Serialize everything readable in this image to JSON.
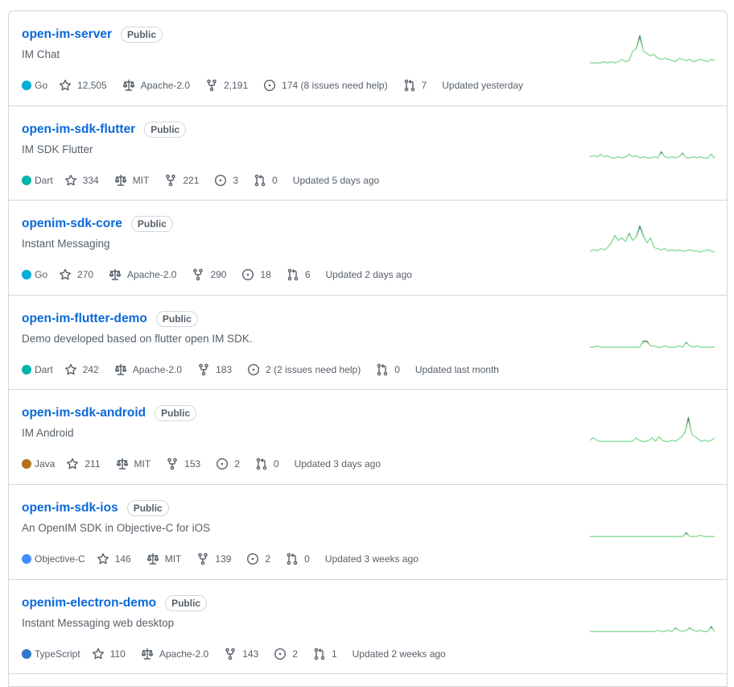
{
  "repos": [
    {
      "name": "open-im-server",
      "visibility": "Public",
      "description": "IM Chat",
      "language": "Go",
      "language_color": "#00ADD8",
      "stars": "12,505",
      "license": "Apache-2.0",
      "forks": "2,191",
      "issues": "174 (8 issues need help)",
      "pulls": "7",
      "updated": "Updated yesterday",
      "activity": [
        2,
        2,
        2,
        2,
        3,
        2,
        3,
        2,
        3,
        5,
        3,
        4,
        12,
        14,
        25,
        12,
        10,
        8,
        9,
        6,
        5,
        6,
        5,
        4,
        3,
        6,
        5,
        4,
        5,
        3,
        4,
        5,
        4,
        3,
        5,
        4
      ]
    },
    {
      "name": "open-im-sdk-flutter",
      "visibility": "Public",
      "description": "IM SDK Flutter",
      "language": "Dart",
      "language_color": "#00B4AB",
      "stars": "334",
      "license": "MIT",
      "forks": "221",
      "issues": "3",
      "pulls": "0",
      "updated": "Updated 5 days ago",
      "activity": [
        3,
        4,
        3,
        5,
        3,
        4,
        2,
        2,
        3,
        2,
        3,
        5,
        3,
        4,
        2,
        3,
        2,
        2,
        3,
        2,
        7,
        3,
        2,
        3,
        2,
        3,
        6,
        2,
        2,
        3,
        2,
        3,
        2,
        2,
        5,
        2
      ]
    },
    {
      "name": "openim-sdk-core",
      "visibility": "Public",
      "description": "Instant Messaging",
      "language": "Go",
      "language_color": "#00ADD8",
      "stars": "270",
      "license": "Apache-2.0",
      "forks": "290",
      "issues": "18",
      "pulls": "6",
      "updated": "Updated 2 days ago",
      "activity": [
        3,
        4,
        3,
        5,
        4,
        6,
        10,
        16,
        12,
        14,
        11,
        18,
        12,
        15,
        24,
        16,
        10,
        14,
        6,
        5,
        4,
        5,
        3,
        4,
        3,
        4,
        3,
        3,
        4,
        3,
        3,
        2,
        3,
        4,
        3,
        2
      ]
    },
    {
      "name": "open-im-flutter-demo",
      "visibility": "Public",
      "description": "Demo developed based on flutter open IM SDK.",
      "language": "Dart",
      "language_color": "#00B4AB",
      "stars": "242",
      "license": "Apache-2.0",
      "forks": "183",
      "issues": "2 (2 issues need help)",
      "pulls": "0",
      "updated": "Updated last month",
      "activity": [
        2,
        2,
        3,
        2,
        2,
        2,
        2,
        2,
        2,
        2,
        2,
        2,
        2,
        2,
        2,
        7,
        7,
        3,
        3,
        2,
        2,
        3,
        2,
        2,
        2,
        3,
        2,
        6,
        3,
        2,
        3,
        2,
        2,
        2,
        2,
        2
      ]
    },
    {
      "name": "open-im-sdk-android",
      "visibility": "Public",
      "description": "IM Android",
      "language": "Java",
      "language_color": "#b07219",
      "stars": "211",
      "license": "MIT",
      "forks": "153",
      "issues": "2",
      "pulls": "0",
      "updated": "Updated 3 days ago",
      "activity": [
        3,
        5,
        3,
        2,
        2,
        2,
        2,
        2,
        2,
        2,
        2,
        2,
        2,
        2,
        5,
        3,
        2,
        2,
        3,
        5,
        2,
        6,
        3,
        2,
        2,
        3,
        2,
        4,
        6,
        10,
        22,
        8,
        6,
        4,
        2,
        3,
        2,
        3,
        5
      ]
    },
    {
      "name": "open-im-sdk-ios",
      "visibility": "Public",
      "description": "An OpenIM SDK in Objective-C for iOS",
      "language": "Objective-C",
      "language_color": "#438eff",
      "stars": "146",
      "license": "MIT",
      "forks": "139",
      "issues": "2",
      "pulls": "0",
      "updated": "Updated 3 weeks ago",
      "activity": [
        2,
        2,
        2,
        2,
        2,
        2,
        2,
        2,
        2,
        2,
        2,
        2,
        2,
        2,
        2,
        2,
        2,
        2,
        2,
        2,
        2,
        2,
        2,
        2,
        2,
        2,
        2,
        5,
        2,
        2,
        2,
        3,
        2,
        2,
        2,
        2
      ]
    },
    {
      "name": "openim-electron-demo",
      "visibility": "Public",
      "description": "Instant Messaging web desktop",
      "language": "TypeScript",
      "language_color": "#3178c6",
      "stars": "110",
      "license": "Apache-2.0",
      "forks": "143",
      "issues": "2",
      "pulls": "1",
      "updated": "Updated 2 weeks ago",
      "activity": [
        2,
        2,
        2,
        2,
        2,
        2,
        2,
        2,
        2,
        2,
        2,
        2,
        2,
        2,
        2,
        2,
        2,
        2,
        2,
        3,
        2,
        2,
        3,
        2,
        5,
        3,
        2,
        3,
        5,
        3,
        2,
        3,
        2,
        2,
        6,
        2
      ]
    }
  ],
  "icons": {
    "star": "star-icon",
    "license": "law-icon",
    "fork": "fork-icon",
    "issues": "issue-opened-icon",
    "pulls": "pull-request-icon"
  },
  "colors": {
    "link": "#0969da",
    "muted": "#57606a",
    "border": "#d0d7de",
    "spark_light": "#8fde9e",
    "spark_dark": "#40895a"
  }
}
